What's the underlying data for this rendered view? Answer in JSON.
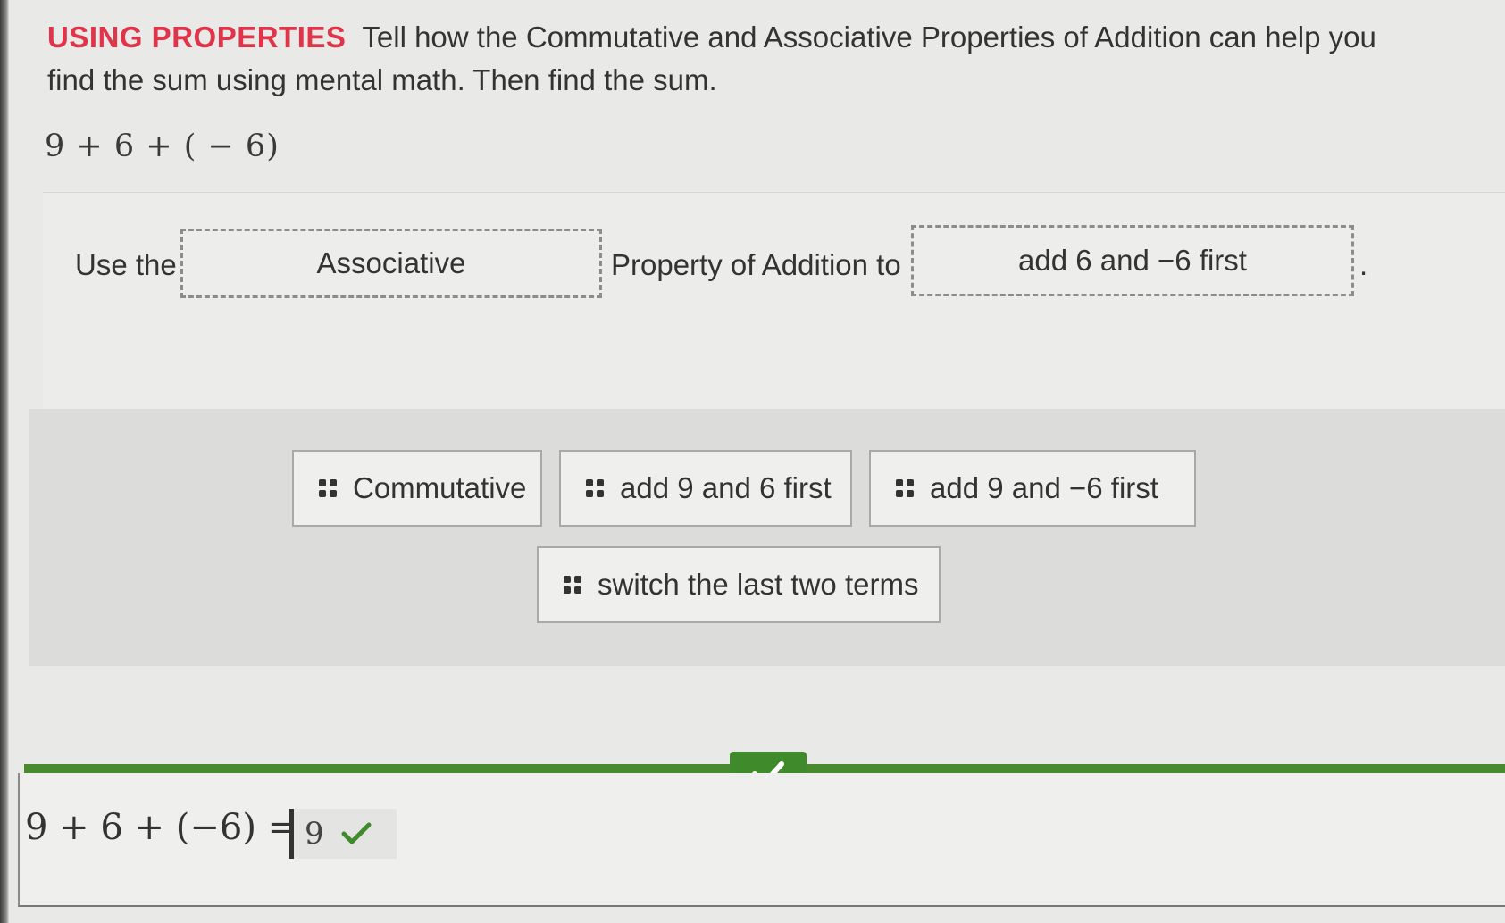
{
  "prompt": {
    "label": "USING PROPERTIES",
    "text": "Tell how the Commutative and Associative Properties of Addition can help you find the sum using mental math. Then find the sum."
  },
  "expression": "9 + 6 + ( − 6)",
  "sentence": {
    "part1": "Use the",
    "blank1": "Associative",
    "part2": "Property of Addition to",
    "blank2": "add 6 and −6 first",
    "end": "."
  },
  "tiles": [
    {
      "label": "Commutative"
    },
    {
      "label": "add 9 and 6 first"
    },
    {
      "label": "add 9 and −6 first"
    },
    {
      "label": "switch the last two terms"
    }
  ],
  "result": {
    "equation": "9 + 6 + (−6) =",
    "answer": "9",
    "status": "correct"
  },
  "colors": {
    "label_red": "#e0344a",
    "correct_green": "#3f8a2a"
  },
  "icons": {
    "drag_handle": "grip-icon",
    "correct": "checkmark-icon"
  }
}
